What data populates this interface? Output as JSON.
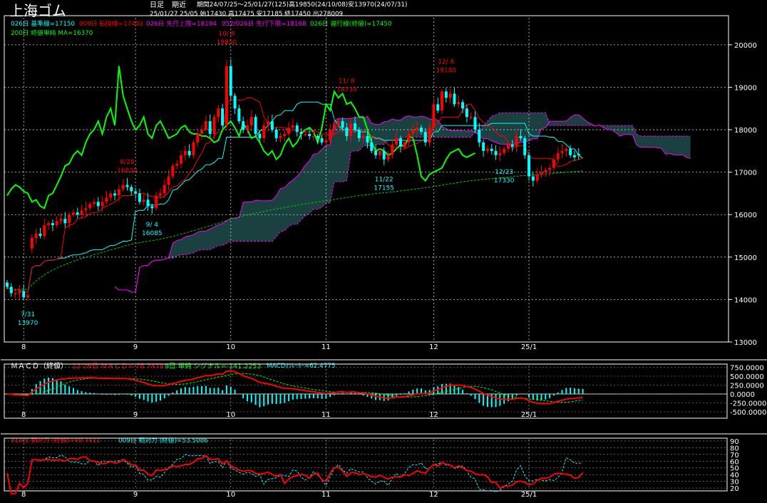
{
  "header": {
    "title": "上海ゴム",
    "period_type": "日足",
    "contract": "期近",
    "info1": "期間24/07/25～25/01/27(125)高19850(24/10/08)安13970(24/07/31)",
    "info2": "25/01/27 25/05 始17430 高17475 安17185 終17450 出278009"
  },
  "legend": {
    "kijun": "026日 基準線=17150",
    "tenkan": "009日 転換線=17403",
    "span_a": "026日 先行上限=18194",
    "span_b": "052/026日 先行下限=18168",
    "chikou": "026日 遅行線(終値)=17450",
    "ma200": "200日 終値単純 MA=16370"
  },
  "macd_legend": {
    "title": "ＭＡＣＤ（終値）",
    "macd": "12-26日 ＭＡＣＤ=-78.7478",
    "signal": "9日 単純 シグナル=-141.2253",
    "osc": "MACDｵｼﾚｰﾀｰ=62.4775"
  },
  "rsi_legend": {
    "rsi14": "014日 相対力 (終値)=49.7411",
    "rsi9": "009日 相対力 (終値)=53.5086"
  },
  "colors": {
    "up": "#ff0000",
    "down": "#00ffff",
    "kijun": "#00ffff",
    "tenkan": "#ff0000",
    "chikou": "#00ff00",
    "span_a": "#ff00ff",
    "span_b": "#ff00ff",
    "cloud": "#66ffff",
    "ma200": "#00cc00",
    "grid": "#ffffff"
  },
  "chart_data": [
    {
      "type": "candlestick",
      "ylim": [
        13000,
        20300
      ],
      "x_labels": [
        {
          "index": 4,
          "label": "8"
        },
        {
          "index": 31,
          "label": "9"
        },
        {
          "index": 54,
          "label": "10"
        },
        {
          "index": 77,
          "label": "11"
        },
        {
          "index": 103,
          "label": "12"
        },
        {
          "index": 126,
          "label": "25/1"
        }
      ],
      "y_ticks": [
        13000,
        14000,
        15000,
        16000,
        17000,
        18000,
        19000,
        20000
      ],
      "annotations": [
        {
          "index": 5,
          "date": "7/31",
          "value": 13970,
          "color": "#00ffff",
          "pos": "below"
        },
        {
          "index": 29,
          "date": "8/28",
          "value": 16830,
          "color": "#ff0000",
          "pos": "above"
        },
        {
          "index": 35,
          "date": "9/ 4",
          "value": 16085,
          "color": "#00ffff",
          "pos": "below"
        },
        {
          "index": 53,
          "date": "10/ 8",
          "value": 19850,
          "color": "#ff0000",
          "pos": "above"
        },
        {
          "index": 82,
          "date": "11/ 8",
          "value": 18730,
          "color": "#ff0000",
          "pos": "above"
        },
        {
          "index": 91,
          "date": "11/22",
          "value": 17155,
          "color": "#00ffff",
          "pos": "below"
        },
        {
          "index": 106,
          "date": "12/ 6",
          "value": 19180,
          "color": "#ff0000",
          "pos": "above"
        },
        {
          "index": 120,
          "date": "12/23",
          "value": 17330,
          "color": "#00ffff",
          "pos": "below"
        }
      ],
      "closes": [
        14300,
        14150,
        14150,
        14200,
        14050,
        14100,
        15450,
        15550,
        15500,
        15750,
        15800,
        15750,
        15850,
        15900,
        15800,
        16000,
        16050,
        16000,
        16100,
        16150,
        16250,
        16300,
        16200,
        16300,
        16400,
        16500,
        16450,
        16600,
        16700,
        16650,
        16550,
        16500,
        16300,
        16350,
        16200,
        16150,
        16450,
        16500,
        16700,
        16900,
        17150,
        17200,
        17400,
        17500,
        17400,
        17700,
        17900,
        18000,
        18200,
        17900,
        18300,
        18500,
        18100,
        19500,
        18800,
        18500,
        18200,
        18000,
        18100,
        18300,
        17900,
        17800,
        18100,
        18200,
        18000,
        17800,
        17850,
        17900,
        18050,
        18100,
        17950,
        17900,
        17900,
        17850,
        17850,
        17800,
        17700,
        17750,
        18000,
        18100,
        18200,
        18050,
        17850,
        18150,
        18000,
        17800,
        17850,
        17700,
        17500,
        17400,
        17500,
        17300,
        17400,
        17650,
        17800,
        17600,
        17700,
        17900,
        18000,
        18050,
        17950,
        17700,
        18050,
        18600,
        18450,
        18900,
        18750,
        18850,
        18600,
        18650,
        18500,
        18300,
        18300,
        18000,
        17700,
        17500,
        17550,
        17500,
        17400,
        17450,
        17550,
        17650,
        17600,
        17850,
        17800,
        17400,
        16900,
        16800,
        16950,
        17000,
        17050,
        17100,
        17300,
        17450,
        17500,
        17550,
        17400,
        17350,
        17400,
        17450
      ],
      "opens": [
        14400,
        14300,
        14150,
        14150,
        14200,
        14050,
        15200,
        15450,
        15550,
        15500,
        15750,
        15800,
        15750,
        15850,
        15900,
        15800,
        16000,
        16050,
        16000,
        16100,
        16150,
        16250,
        16300,
        16200,
        16300,
        16400,
        16500,
        16450,
        16600,
        16700,
        16650,
        16550,
        16500,
        16300,
        16350,
        16200,
        16150,
        16450,
        16500,
        16700,
        16900,
        17150,
        17200,
        17400,
        17500,
        17400,
        17700,
        17900,
        18000,
        18200,
        17900,
        18300,
        18500,
        18100,
        19500,
        18800,
        18500,
        18200,
        18000,
        18100,
        18300,
        17900,
        17800,
        18100,
        18200,
        18000,
        17800,
        17850,
        17900,
        18050,
        18100,
        17950,
        17900,
        17900,
        17850,
        17850,
        17800,
        17700,
        17750,
        18000,
        18100,
        18200,
        18050,
        17850,
        18150,
        18000,
        17800,
        17850,
        17700,
        17500,
        17400,
        17500,
        17300,
        17400,
        17650,
        17800,
        17600,
        17700,
        17900,
        18000,
        18050,
        17950,
        17700,
        18050,
        18600,
        18450,
        18900,
        18750,
        18850,
        18600,
        18650,
        18500,
        18300,
        18300,
        18000,
        17700,
        17500,
        17550,
        17500,
        17400,
        17450,
        17550,
        17650,
        17600,
        17850,
        17800,
        17400,
        16900,
        16800,
        16950,
        17000,
        17050,
        17100,
        17300,
        17450,
        17500,
        17550,
        17400,
        17430
      ]
    },
    {
      "type": "line",
      "name": "ＭＡＣＤ",
      "ylim": [
        -600,
        800
      ],
      "y_ticks": [
        750,
        500,
        250,
        0,
        -250,
        -500
      ]
    },
    {
      "type": "line",
      "name": "相対力",
      "ylim": [
        18,
        92
      ],
      "y_ticks": [
        90,
        80,
        70,
        60,
        50,
        40,
        30,
        20
      ]
    }
  ]
}
